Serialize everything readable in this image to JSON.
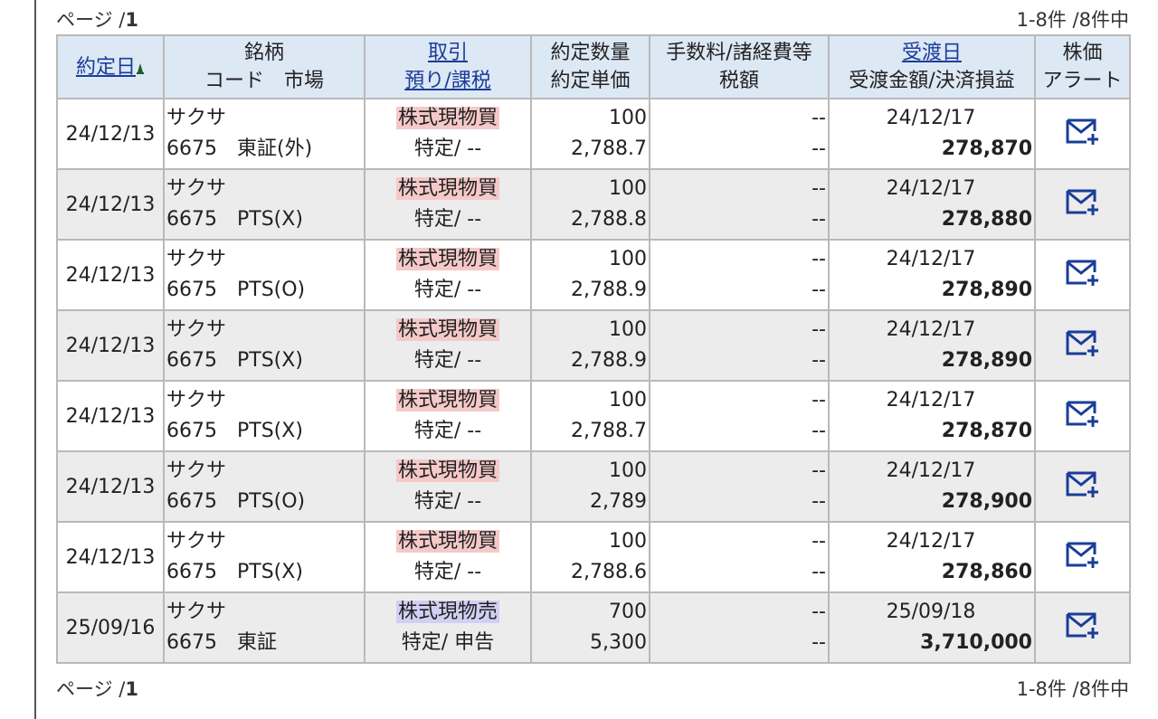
{
  "pager": {
    "page_prefix": "ページ /",
    "total_pages": "1",
    "count_text": "1-8件 /8件中"
  },
  "header": {
    "col1": "約定日",
    "col2_line1": "銘柄",
    "col2_line2": "コード　市場",
    "col3_line1": "取引",
    "col3_line2": "預り/課税",
    "col4_line1": "約定数量",
    "col4_line2": "約定単価",
    "col5_line1": "手数料/諸経費等",
    "col5_line2": "税額",
    "col6_line1": "受渡日",
    "col6_line2": "受渡金額/決済損益",
    "col7_line1": "株価",
    "col7_line2": "アラート"
  },
  "colors": {
    "header_bg": "#dde8f5",
    "link": "#1a3d99",
    "buy_bg": "#f6c9c9",
    "sell_bg": "#d2cff4",
    "alt_row_bg": "#ececec",
    "icon": "#1a3d99"
  },
  "alert_icon": "mail-plus-icon",
  "rows": [
    {
      "date": "24/12/13",
      "name": "サクサ",
      "code_market": "6675　東証(外)",
      "trade": "株式現物買",
      "trade_type": "buy",
      "account": "特定/ --",
      "qty": "100",
      "price": "2,788.7",
      "fee": "--",
      "tax": "--",
      "settle_date": "24/12/17",
      "amount": "278,870"
    },
    {
      "date": "24/12/13",
      "name": "サクサ",
      "code_market": "6675　PTS(X)",
      "trade": "株式現物買",
      "trade_type": "buy",
      "account": "特定/ --",
      "qty": "100",
      "price": "2,788.8",
      "fee": "--",
      "tax": "--",
      "settle_date": "24/12/17",
      "amount": "278,880"
    },
    {
      "date": "24/12/13",
      "name": "サクサ",
      "code_market": "6675　PTS(O)",
      "trade": "株式現物買",
      "trade_type": "buy",
      "account": "特定/ --",
      "qty": "100",
      "price": "2,788.9",
      "fee": "--",
      "tax": "--",
      "settle_date": "24/12/17",
      "amount": "278,890"
    },
    {
      "date": "24/12/13",
      "name": "サクサ",
      "code_market": "6675　PTS(X)",
      "trade": "株式現物買",
      "trade_type": "buy",
      "account": "特定/ --",
      "qty": "100",
      "price": "2,788.9",
      "fee": "--",
      "tax": "--",
      "settle_date": "24/12/17",
      "amount": "278,890"
    },
    {
      "date": "24/12/13",
      "name": "サクサ",
      "code_market": "6675　PTS(X)",
      "trade": "株式現物買",
      "trade_type": "buy",
      "account": "特定/ --",
      "qty": "100",
      "price": "2,788.7",
      "fee": "--",
      "tax": "--",
      "settle_date": "24/12/17",
      "amount": "278,870"
    },
    {
      "date": "24/12/13",
      "name": "サクサ",
      "code_market": "6675　PTS(O)",
      "trade": "株式現物買",
      "trade_type": "buy",
      "account": "特定/ --",
      "qty": "100",
      "price": "2,789",
      "fee": "--",
      "tax": "--",
      "settle_date": "24/12/17",
      "amount": "278,900"
    },
    {
      "date": "24/12/13",
      "name": "サクサ",
      "code_market": "6675　PTS(X)",
      "trade": "株式現物買",
      "trade_type": "buy",
      "account": "特定/ --",
      "qty": "100",
      "price": "2,788.6",
      "fee": "--",
      "tax": "--",
      "settle_date": "24/12/17",
      "amount": "278,860"
    },
    {
      "date": "25/09/16",
      "name": "サクサ",
      "code_market": "6675　東証",
      "trade": "株式現物売",
      "trade_type": "sell",
      "account": "特定/ 申告",
      "qty": "700",
      "price": "5,300",
      "fee": "--",
      "tax": "--",
      "settle_date": "25/09/18",
      "amount": "3,710,000"
    }
  ]
}
